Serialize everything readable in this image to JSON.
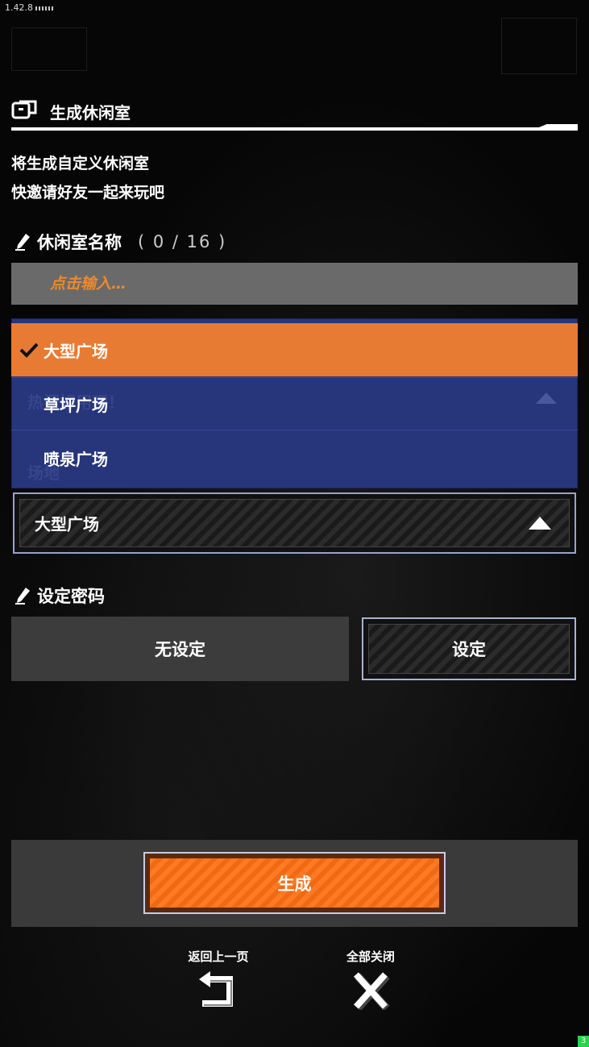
{
  "version": "1.42.8",
  "section": {
    "title": "生成休闲室"
  },
  "description": {
    "line1": "将生成自定义休闲室",
    "line2": "快邀请好友一起来玩吧"
  },
  "room_name": {
    "label": "休闲室名称",
    "counter": "( 0 / 16 )",
    "placeholder": "点击输入…",
    "value": ""
  },
  "venue_dropdown": {
    "options": [
      {
        "label": "大型广场",
        "selected": true
      },
      {
        "label": "草坪广场",
        "selected": false
      },
      {
        "label": "喷泉广场",
        "selected": false
      }
    ],
    "selected_value": "大型广场"
  },
  "password": {
    "label": "设定密码",
    "none_label": "无设定",
    "set_label": "设定"
  },
  "generate_label": "生成",
  "footer": {
    "back_label": "返回上一页",
    "close_all_label": "全部关闭"
  },
  "colors": {
    "accent_orange": "#e77b33",
    "dropdown_blue": "#27357a",
    "input_gray": "#6a6a6a"
  },
  "icons": [
    "chat-room-icon",
    "pencil-icon",
    "checkmark-icon",
    "triangle-up-icon",
    "return-arrow-icon",
    "close-x-icon"
  ]
}
